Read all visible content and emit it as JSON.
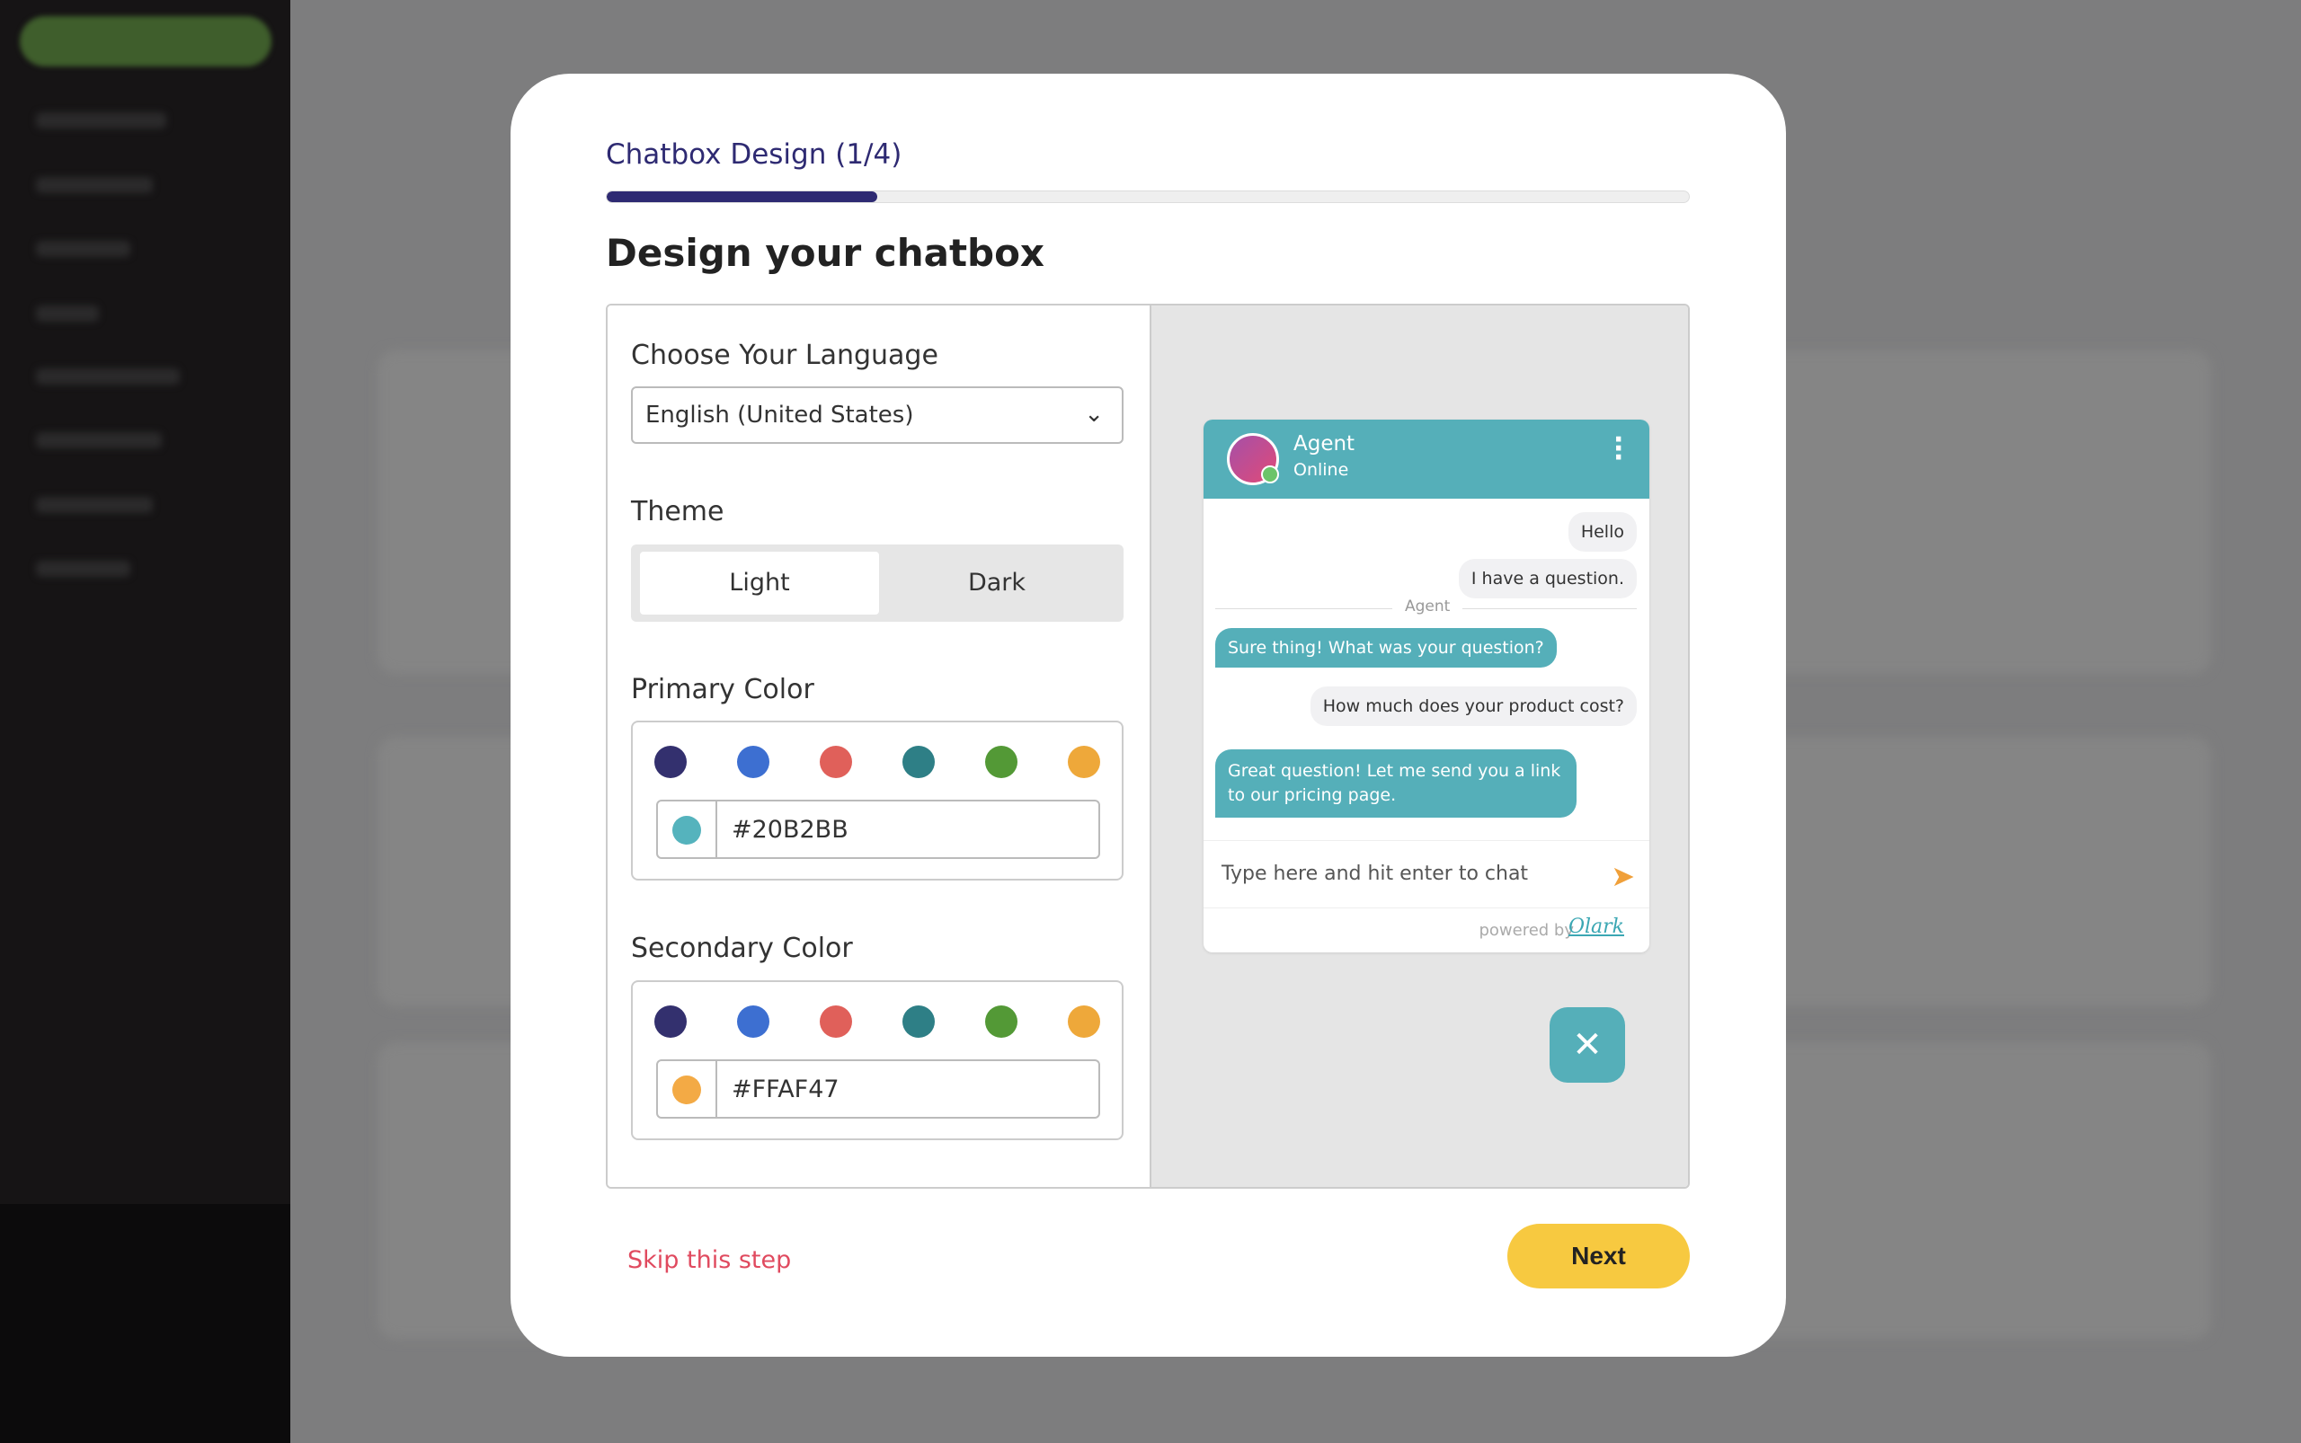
{
  "modal": {
    "step_title": "Chatbox Design (1/4)",
    "progress_percent": 25,
    "heading": "Design your chatbox",
    "language": {
      "label": "Choose Your Language",
      "selected": "English (United States)"
    },
    "theme": {
      "label": "Theme",
      "options": [
        "Light",
        "Dark"
      ],
      "selected": "Light"
    },
    "primary_color": {
      "label": "Primary Color",
      "swatches": [
        "#33306e",
        "#3d6fd1",
        "#e0605a",
        "#2e7f86",
        "#539936",
        "#eea83a"
      ],
      "value": "#20B2BB",
      "swatch_color": "#55b3bd"
    },
    "secondary_color": {
      "label": "Secondary Color",
      "swatches": [
        "#33306e",
        "#3d6fd1",
        "#e0605a",
        "#2e7f86",
        "#539936",
        "#eea83a"
      ],
      "value": "#FFAF47",
      "swatch_color": "#f3aa45"
    },
    "preview": {
      "agent_name": "Agent",
      "agent_status": "Online",
      "messages": [
        "Hello",
        "I have a question.",
        "Sure thing! What was your question?",
        "How much does your product cost?",
        "Great question! Let me send you a link to our pricing page."
      ],
      "separator": "Agent",
      "input_placeholder": "Type here and hit enter to chat",
      "powered_by": "powered by",
      "brand": "Olark"
    },
    "skip_label": "Skip this step",
    "next_label": "Next"
  }
}
